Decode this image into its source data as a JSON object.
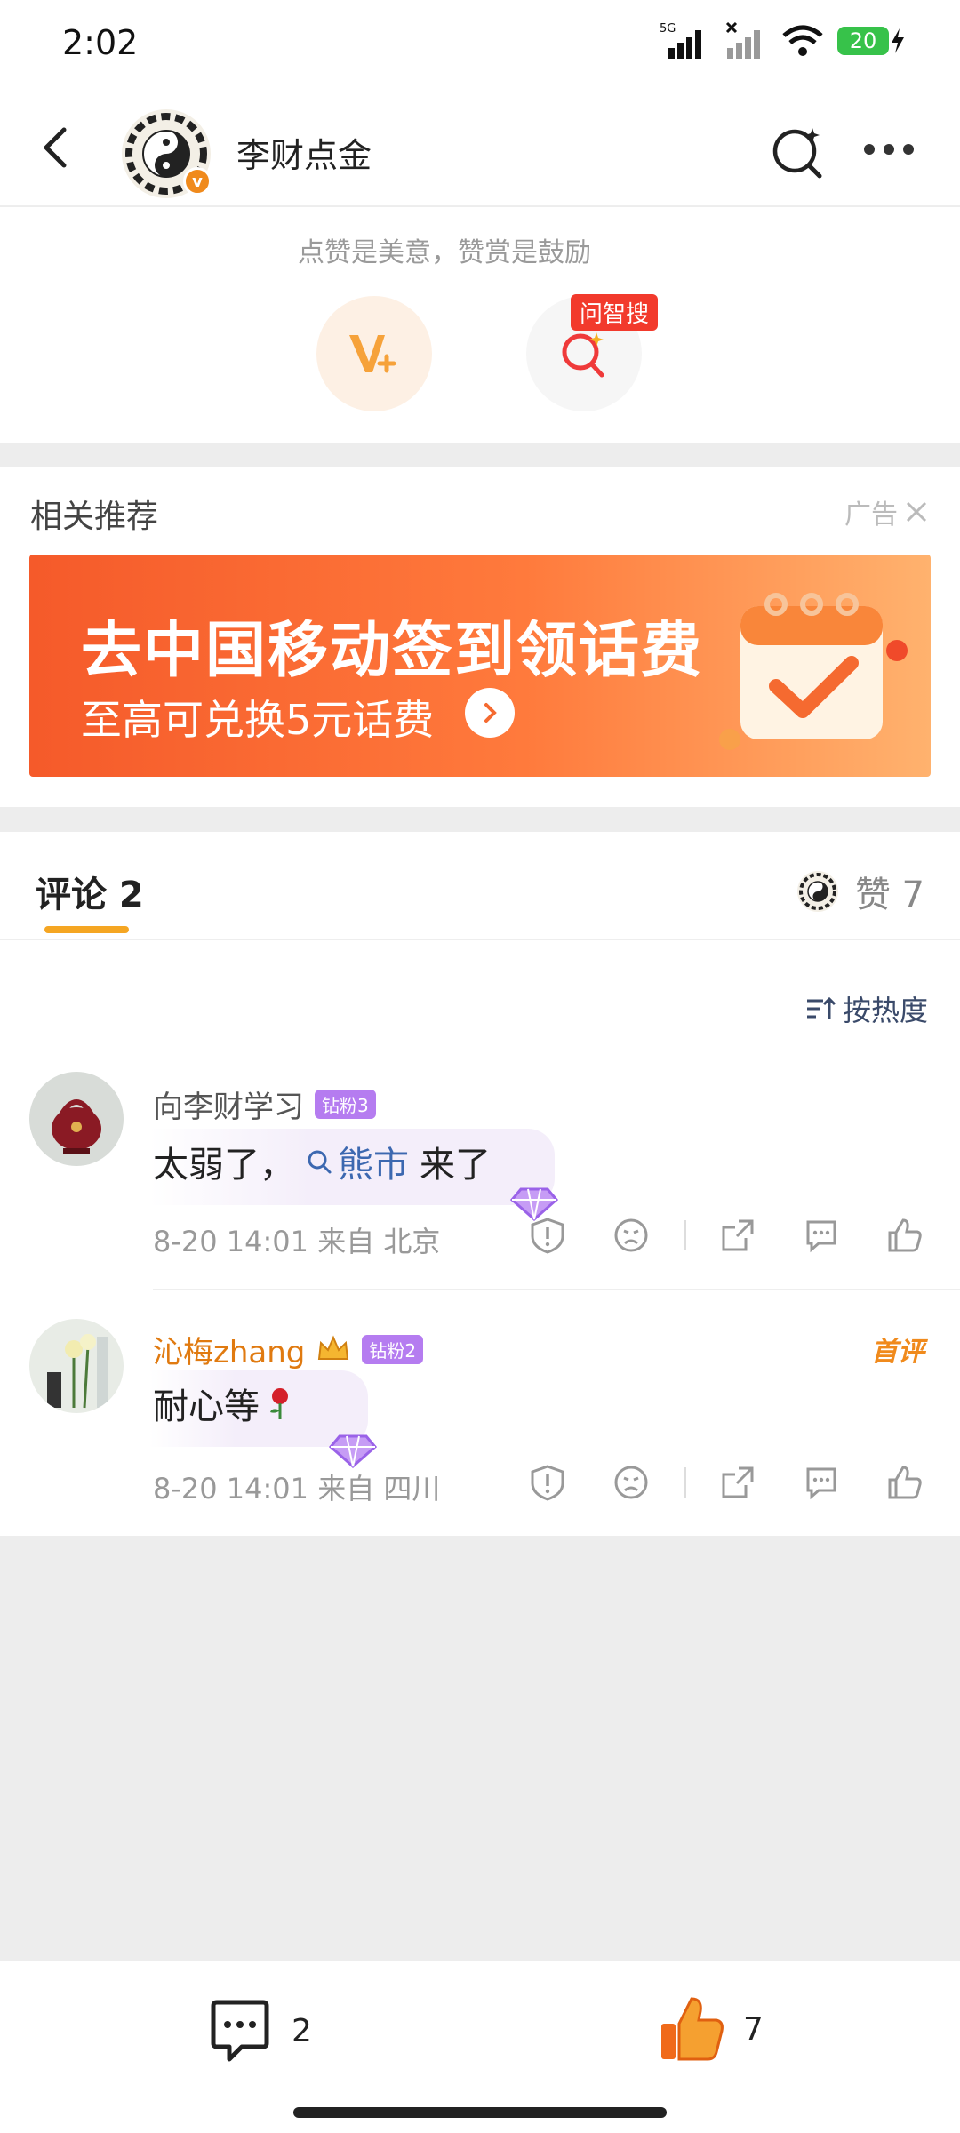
{
  "status_bar": {
    "time": "2:02",
    "network": "5G",
    "battery": "20"
  },
  "header": {
    "title": "李财点金"
  },
  "reward": {
    "slogan": "点赞是美意，赞赏是鼓励",
    "search_tag": "问智搜"
  },
  "ad": {
    "section_title": "相关推荐",
    "ad_label": "广告",
    "banner_headline": "去中国移动签到领话费",
    "banner_sub": "至高可兑换5元话费"
  },
  "comments_section": {
    "tab_label": "评论 2",
    "likes_label": "赞 7",
    "sort_label": "按热度",
    "items": [
      {
        "name": "向李财学习",
        "fan_badge": "钻粉3",
        "text_before": "太弱了，",
        "topic": "熊市",
        "text_after": "来了",
        "time": "8-20 14:01",
        "location": "来自 北京"
      },
      {
        "name": "沁梅zhang",
        "fan_badge": "钻粉2",
        "first_tag": "首评",
        "text_before": "耐心等",
        "time": "8-20 14:01",
        "location": "来自 四川"
      }
    ]
  },
  "bottom_bar": {
    "comment_count": "2",
    "like_count": "7"
  },
  "colors": {
    "accent_orange": "#f08a1c",
    "topic_blue": "#3c68b0",
    "underline": "#f5a623",
    "badge_red": "#f23a2c"
  }
}
